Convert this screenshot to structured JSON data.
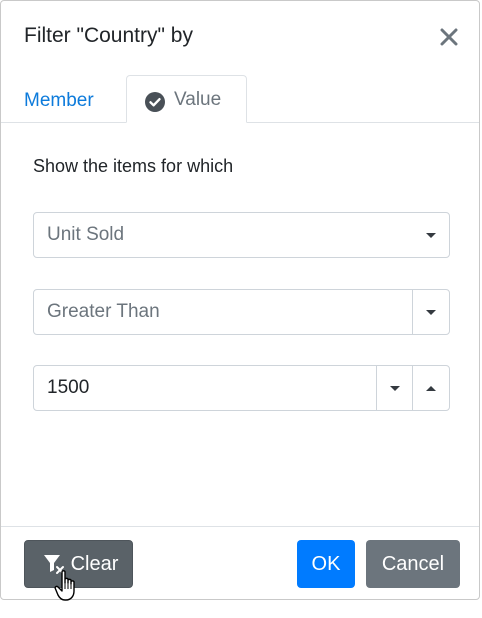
{
  "dialog": {
    "title": "Filter \"Country\" by",
    "close_icon": "close-icon"
  },
  "tabs": [
    {
      "label": "Member",
      "active": false
    },
    {
      "label": "Value",
      "active": true,
      "icon": "check-circle-icon"
    }
  ],
  "value_tab": {
    "instruction": "Show the items for which",
    "measure_select": {
      "value": "Unit Sold"
    },
    "condition_select": {
      "value": "Greater Than"
    },
    "value_input": {
      "value": "1500"
    }
  },
  "footer": {
    "clear_label": "Clear",
    "clear_icon": "filter-clear-icon",
    "ok_label": "OK",
    "cancel_label": "Cancel"
  },
  "colors": {
    "primary": "#007bff",
    "secondary": "#6c757d",
    "dark": "#5a6268",
    "link": "#0d7bdb"
  }
}
